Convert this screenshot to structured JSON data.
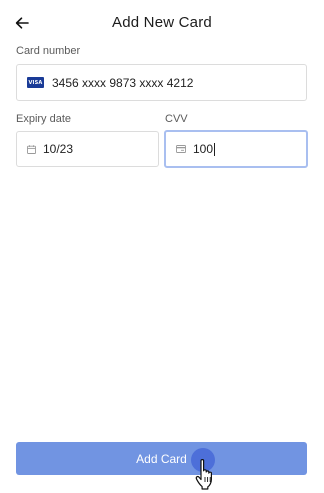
{
  "header": {
    "title": "Add New Card",
    "back_icon": "arrow-left-icon"
  },
  "card_number": {
    "label": "Card number",
    "brand": "VISA",
    "value": "3456 xxxx 9873 xxxx 4212"
  },
  "expiry": {
    "label": "Expiry date",
    "icon": "calendar-icon",
    "value": "10/23"
  },
  "cvv": {
    "label": "CVV",
    "icon": "card-back-icon",
    "value": "100",
    "focused": true
  },
  "submit": {
    "label": "Add Card",
    "color": "#7194e2"
  },
  "colors": {
    "visa_blue": "#1a3b97",
    "focus_border": "#a9bff0"
  }
}
